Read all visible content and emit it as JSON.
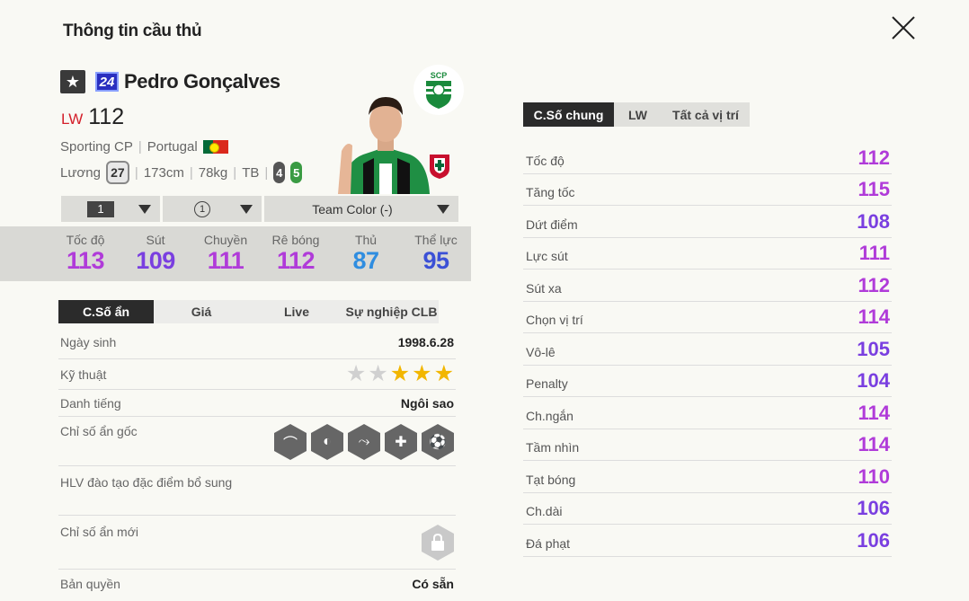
{
  "header": {
    "title": "Thông tin cầu thủ"
  },
  "player": {
    "season": "24",
    "name": "Pedro Gonçalves",
    "position": "LW",
    "ovr": "112",
    "club": "Sporting CP",
    "nation": "Portugal",
    "salary_label": "Lương",
    "salary": "27",
    "height": "173cm",
    "weight": "78kg",
    "body": "TB",
    "left_foot": "4",
    "right_foot": "5",
    "club_logo_text": "SCP"
  },
  "selectors": {
    "level": "1",
    "grade": "1",
    "team_color": "Team Color (-)"
  },
  "summary_stats": [
    {
      "label": "Tốc độ",
      "value": "113",
      "color": "#b03bd9"
    },
    {
      "label": "Sút",
      "value": "109",
      "color": "#7a3fe0"
    },
    {
      "label": "Chuyền",
      "value": "111",
      "color": "#b03bd9"
    },
    {
      "label": "Rê bóng",
      "value": "112",
      "color": "#b03bd9"
    },
    {
      "label": "Thủ",
      "value": "87",
      "color": "#2f8de0"
    },
    {
      "label": "Thể lực",
      "value": "95",
      "color": "#3b50d6"
    }
  ],
  "left_tabs": [
    "C.Số ẩn",
    "Giá",
    "Live",
    "Sự nghiệp CLB"
  ],
  "details": {
    "birth_label": "Ngày sinh",
    "birth": "1998.6.28",
    "skill_label": "Kỹ thuật",
    "skill_stars": 3,
    "skill_max": 5,
    "rep_label": "Danh tiếng",
    "rep": "Ngôi sao",
    "traits_label": "Chỉ số ẩn gốc",
    "coach_label": "HLV đào tạo đặc điểm bổ sung",
    "new_traits_label": "Chỉ số ẩn mới",
    "license_label": "Bản quyền",
    "license": "Có sẵn"
  },
  "right_tabs": [
    "C.Số chung",
    "LW",
    "Tất cả vị trí"
  ],
  "attributes": [
    {
      "name": "Tốc độ",
      "value": "112",
      "color": "#b03bd9"
    },
    {
      "name": "Tăng tốc",
      "value": "115",
      "color": "#b03bd9"
    },
    {
      "name": "Dứt điểm",
      "value": "108",
      "color": "#7a3fe0"
    },
    {
      "name": "Lực sút",
      "value": "111",
      "color": "#b03bd9"
    },
    {
      "name": "Sút xa",
      "value": "112",
      "color": "#b03bd9"
    },
    {
      "name": "Chọn vị trí",
      "value": "114",
      "color": "#b03bd9"
    },
    {
      "name": "Vô-lê",
      "value": "105",
      "color": "#7a3fe0"
    },
    {
      "name": "Penalty",
      "value": "104",
      "color": "#7a3fe0"
    },
    {
      "name": "Ch.ngắn",
      "value": "114",
      "color": "#b03bd9"
    },
    {
      "name": "Tầm nhìn",
      "value": "114",
      "color": "#b03bd9"
    },
    {
      "name": "Tạt bóng",
      "value": "110",
      "color": "#b03bd9"
    },
    {
      "name": "Ch.dài",
      "value": "106",
      "color": "#7a3fe0"
    },
    {
      "name": "Đá phạt",
      "value": "106",
      "color": "#7a3fe0"
    }
  ]
}
